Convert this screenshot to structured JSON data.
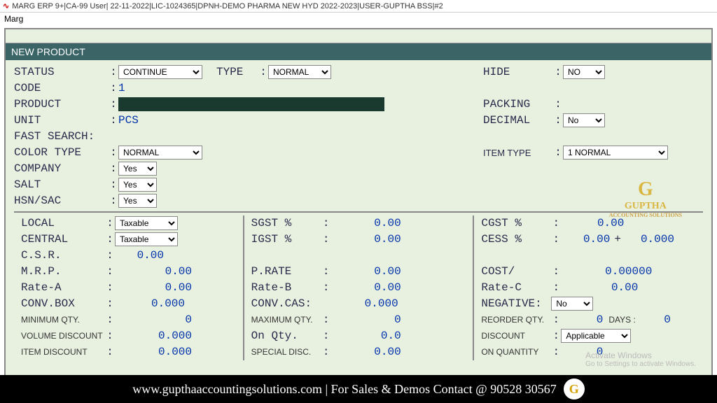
{
  "titlebar": "MARG ERP 9+|CA-99 User| 22-11-2022|LIC-1024365|DPNH-DEMO PHARMA NEW HYD 2022-2023|USER-GUPTHA BSS|#2",
  "menubar": "Marg",
  "header": "NEW PRODUCT",
  "labels": {
    "status": "STATUS",
    "type": "TYPE",
    "hide": "HIDE",
    "code": "CODE",
    "product": "PRODUCT",
    "packing": "PACKING",
    "unit": "UNIT",
    "decimal": "DECIMAL",
    "fastsearch": "FAST SEARCH:",
    "colortype": "COLOR TYPE",
    "itemtype": "ITEM TYPE",
    "company": "COMPANY",
    "salt": "SALT",
    "hsnsac": "HSN/SAC",
    "local": "LOCAL",
    "central": "CENTRAL",
    "csr": "C.S.R.",
    "mrp": "M.R.P.",
    "ratea": "Rate-A",
    "convbox": "CONV.BOX",
    "minqty": "MINIMUM QTY.",
    "voldisc": "VOLUME DISCOUNT",
    "itemdisc": "ITEM DISCOUNT",
    "sgst": "SGST %",
    "igst": "IGST %",
    "prate": "P.RATE",
    "rateb": "Rate-B",
    "convcas": "CONV.CAS:",
    "maxqty": "MAXIMUM QTY.",
    "onqty": "On Qty.",
    "specdisc": "SPECIAL DISC.",
    "cgst": "CGST %",
    "cess": "CESS %",
    "cost": "COST/",
    "ratec": "Rate-C",
    "negative": "NEGATIVE:",
    "reorder": "REORDER QTY.",
    "days": "DAYS :",
    "discount": "DISCOUNT",
    "onquantity": "ON QUANTITY",
    "plus": "+"
  },
  "values": {
    "status": "CONTINUE",
    "type": "NORMAL",
    "hide": "NO",
    "code": "1",
    "unit": "PCS",
    "decimal": "No",
    "colortype": "NORMAL",
    "itemtype": "1 NORMAL",
    "company": "Yes",
    "salt": "Yes",
    "hsnsac": "Yes",
    "local": "Taxable",
    "central": "Taxable",
    "csr": "0.00",
    "mrp": "0.00",
    "ratea": "0.00",
    "convbox": "0.000",
    "minqty": "0",
    "voldisc": "0.000",
    "itemdisc": "0.000",
    "sgst": "0.00",
    "igst": "0.00",
    "prate": "0.00",
    "rateb": "0.00",
    "convcas": "0.000",
    "maxqty": "0",
    "onqty": "0.0",
    "specdisc": "0.00",
    "cgst": "0.00",
    "cess1": "0.00",
    "cess2": "0.000",
    "cost": "0.00000",
    "ratec": "0.00",
    "negative": "No",
    "reorder": "0",
    "days": "0",
    "discount": "Applicable",
    "onquantity": "0"
  },
  "watermark": {
    "g": "G",
    "name": "GUPTHA",
    "sub": "ACCOUNTING SOLUTIONS"
  },
  "activate": {
    "line1": "Activate Windows",
    "line2": "Go to Settings to activate Windows."
  },
  "footer": "www.gupthaaccountingsolutions.com | For Sales & Demos Contact @ 90528 30567"
}
